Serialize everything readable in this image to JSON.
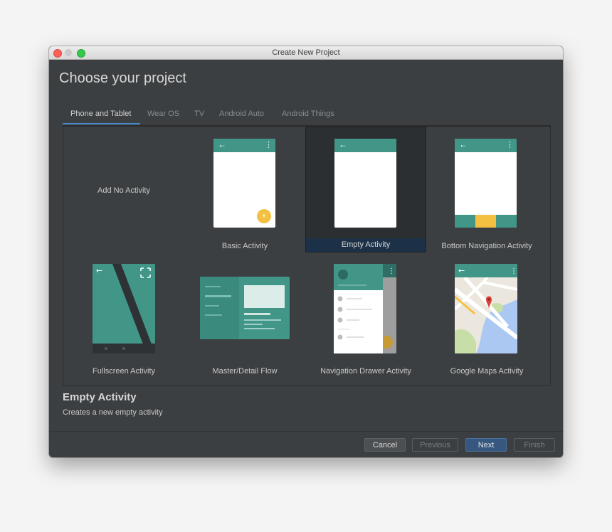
{
  "window": {
    "title": "Create New Project"
  },
  "heading": "Choose your project",
  "tabs": [
    {
      "label": "Phone and Tablet",
      "active": true
    },
    {
      "label": "Wear OS",
      "active": false
    },
    {
      "label": "TV",
      "active": false
    },
    {
      "label": "Android Auto",
      "active": false
    },
    {
      "label": "Android Things",
      "active": false
    }
  ],
  "templates": [
    {
      "label": "Add No Activity",
      "selected": false
    },
    {
      "label": "Basic Activity",
      "selected": false
    },
    {
      "label": "Empty Activity",
      "selected": true
    },
    {
      "label": "Bottom Navigation Activity",
      "selected": false
    },
    {
      "label": "Fullscreen Activity",
      "selected": false
    },
    {
      "label": "Master/Detail Flow",
      "selected": false
    },
    {
      "label": "Navigation Drawer Activity",
      "selected": false
    },
    {
      "label": "Google Maps Activity",
      "selected": false
    }
  ],
  "description": {
    "title": "Empty Activity",
    "text": "Creates a new empty activity"
  },
  "buttons": {
    "cancel": "Cancel",
    "previous": "Previous",
    "next": "Next",
    "finish": "Finish"
  },
  "colors": {
    "accent": "#4a88c7",
    "template_teal": "#419688",
    "fab_yellow": "#f4c041",
    "selected_label_bg": "#1c3147",
    "primary_button": "#365880"
  }
}
